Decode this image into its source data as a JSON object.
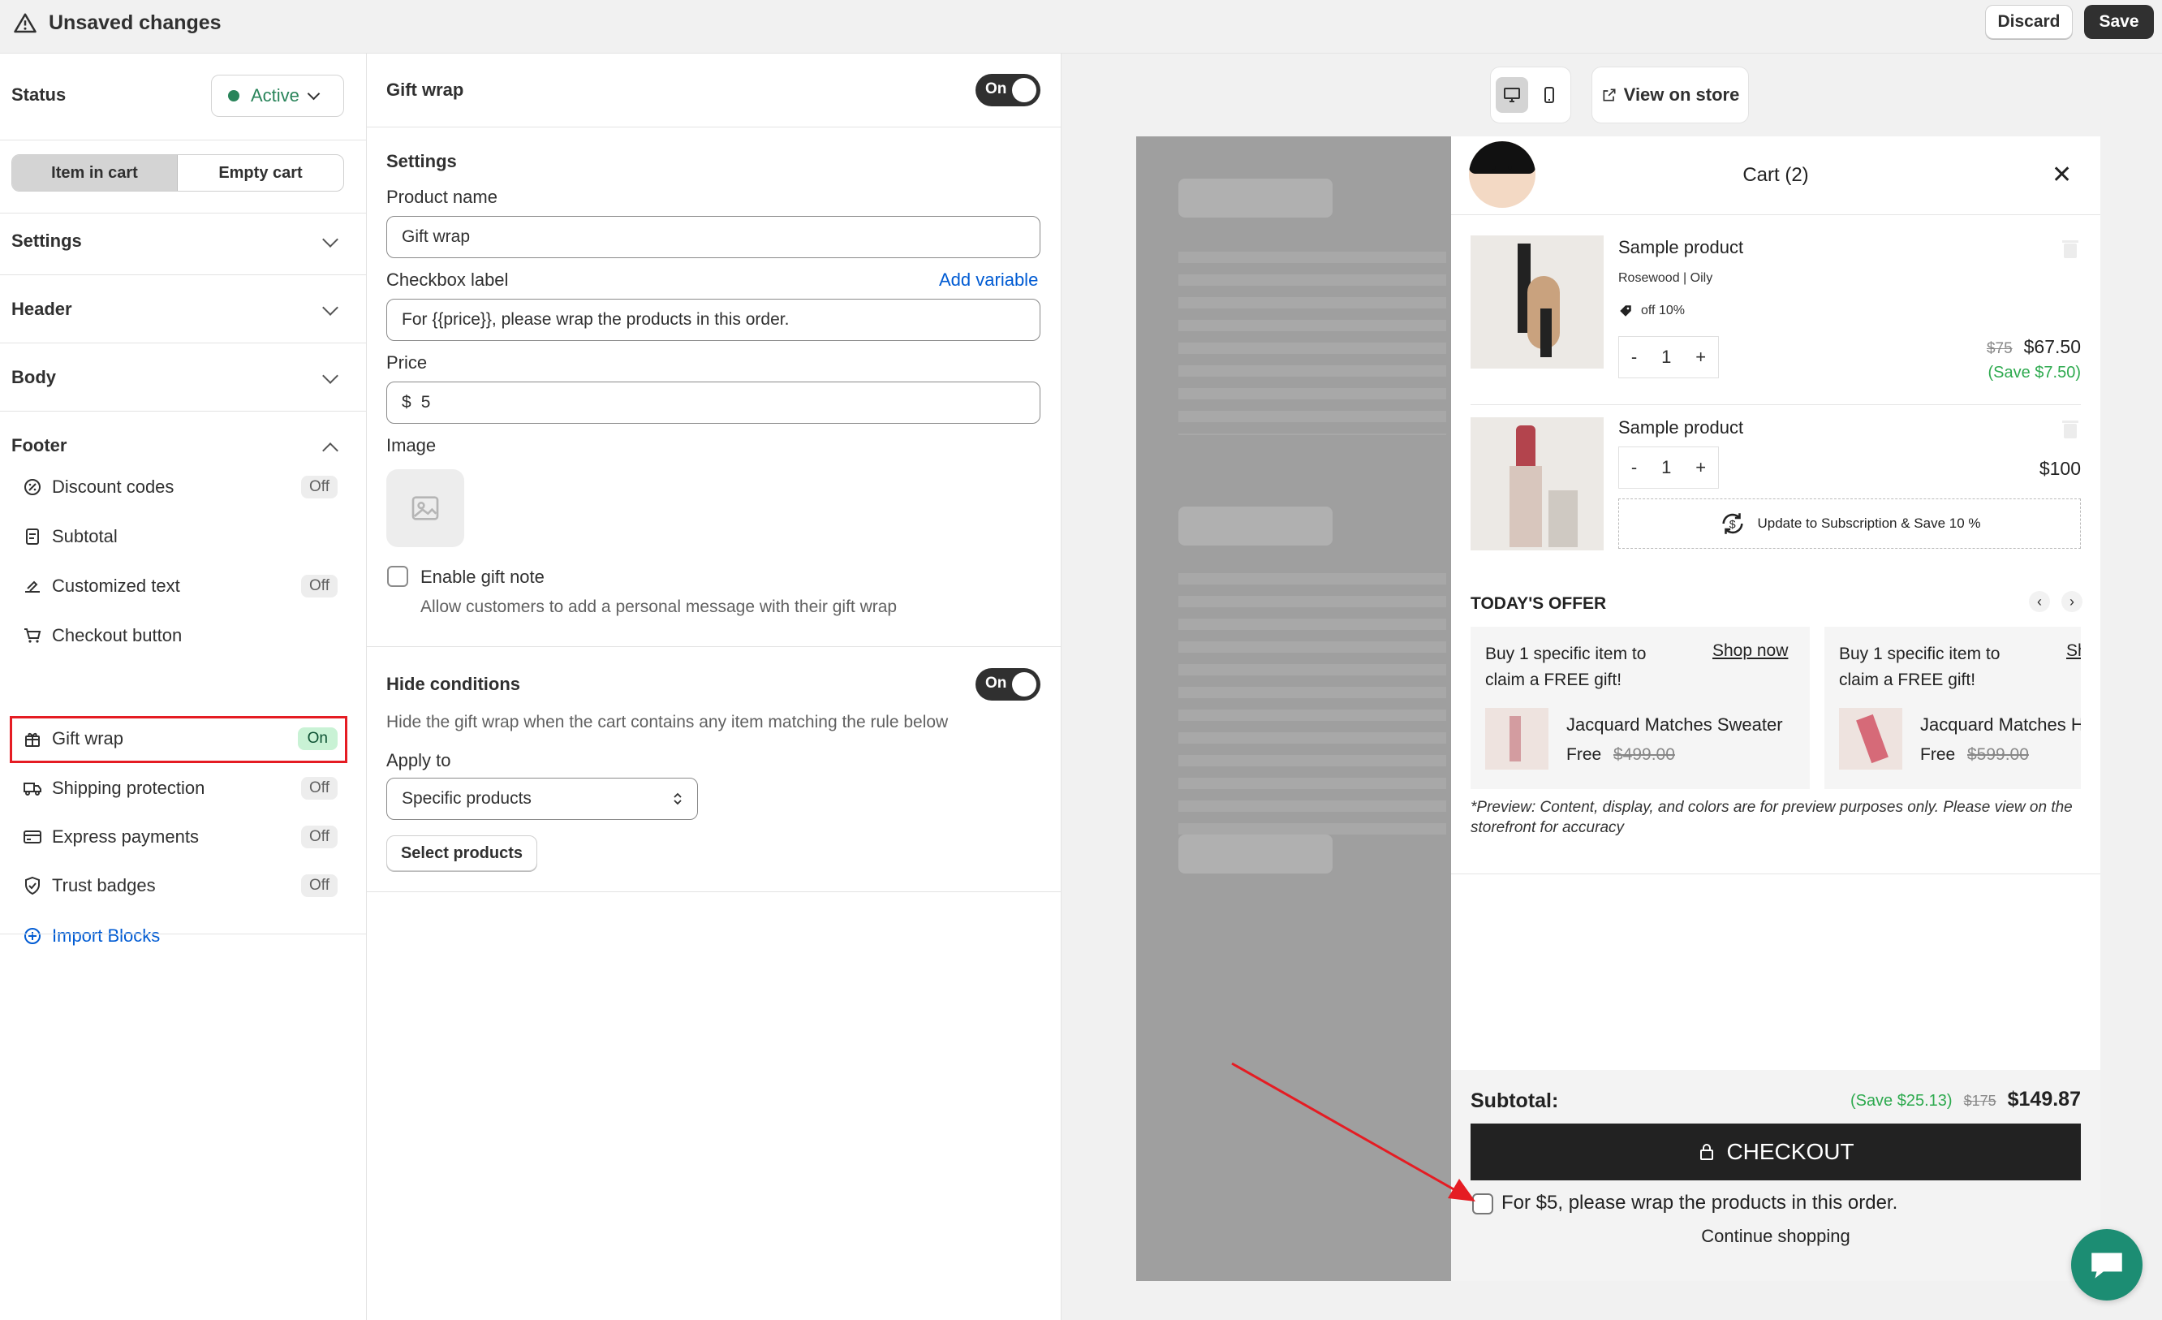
{
  "topbar": {
    "title": "Unsaved changes",
    "discard": "Discard",
    "save": "Save"
  },
  "left": {
    "status_label": "Status",
    "status_value": "Active",
    "tab_item": "Item in cart",
    "tab_empty": "Empty cart",
    "sections": [
      "Settings",
      "Header",
      "Body",
      "Footer"
    ],
    "footer_items": [
      {
        "label": "Discount codes",
        "badge": "Off",
        "icon": "discount-icon"
      },
      {
        "label": "Subtotal",
        "badge": "",
        "icon": "receipt-icon"
      },
      {
        "label": "Customized text",
        "badge": "Off",
        "icon": "text-icon"
      },
      {
        "label": "Checkout button",
        "badge": "",
        "icon": "cart-icon"
      },
      {
        "label": "Gift wrap",
        "badge": "On",
        "icon": "gift-icon"
      },
      {
        "label": "Shipping protection",
        "badge": "Off",
        "icon": "truck-icon"
      },
      {
        "label": "Express payments",
        "badge": "Off",
        "icon": "card-icon"
      },
      {
        "label": "Trust badges",
        "badge": "Off",
        "icon": "shield-icon"
      }
    ],
    "import_blocks": "Import Blocks"
  },
  "mid": {
    "gift_title": "Gift wrap",
    "toggle_on": "On",
    "settings": "Settings",
    "product_name_label": "Product name",
    "product_name_value": "Gift wrap",
    "checkbox_label": "Checkbox label",
    "add_variable": "Add variable",
    "checkbox_value": "For {{price}}, please wrap the products in this order.",
    "price_label": "Price",
    "currency": "$",
    "price_value": "5",
    "image_label": "Image",
    "gift_note": "Enable gift note",
    "gift_note_desc": "Allow customers to add a personal message with their gift wrap",
    "hide_title": "Hide conditions",
    "hide_desc": "Hide the gift wrap when the cart contains any item matching the rule below",
    "apply_label": "Apply to",
    "apply_value": "Specific products",
    "select_products": "Select products"
  },
  "preview": {
    "view_on_store": "View on store",
    "cart_title": "Cart (2)",
    "p1_name": "Sample product",
    "p1_variant": "Rosewood | Oily",
    "p1_discount": "off 10%",
    "p1_qty": "1",
    "p1_old": "$75",
    "p1_price": "$67.50",
    "p1_save": "(Save $7.50)",
    "p2_name": "Sample product",
    "p2_qty": "1",
    "p2_price": "$100",
    "subscription": "Update to Subscription & Save 10 %",
    "offer_title": "TODAY'S OFFER",
    "o1_text": "Buy 1 specific item to claim a FREE gift!",
    "o1_link": "Shop now",
    "o1_product": "Jacquard Matches Sweater",
    "o1_free": "Free",
    "o1_old": "$499.00",
    "o2_text": "Buy 1 specific item to claim a FREE gift!",
    "o2_link": "Sh",
    "o2_product": "Jacquard Matches H",
    "o2_free": "Free",
    "o2_old": "$599.00",
    "disclaimer": "*Preview: Content, display, and colors are for preview purposes only. Please view on the storefront for accuracy",
    "subtotal_label": "Subtotal:",
    "subtotal_save": "(Save $25.13)",
    "subtotal_old": "$175",
    "subtotal": "$149.87",
    "checkout": "CHECKOUT",
    "giftwrap_line": "For $5, please wrap the products in this order.",
    "continue": "Continue shopping",
    "minus": "-",
    "plus": "+"
  },
  "colors": {
    "accent_green": "#29845a",
    "link_blue": "#005bd3",
    "dark": "#303030",
    "save_green": "#2eaa4f",
    "highlight_red": "#e51c23"
  }
}
